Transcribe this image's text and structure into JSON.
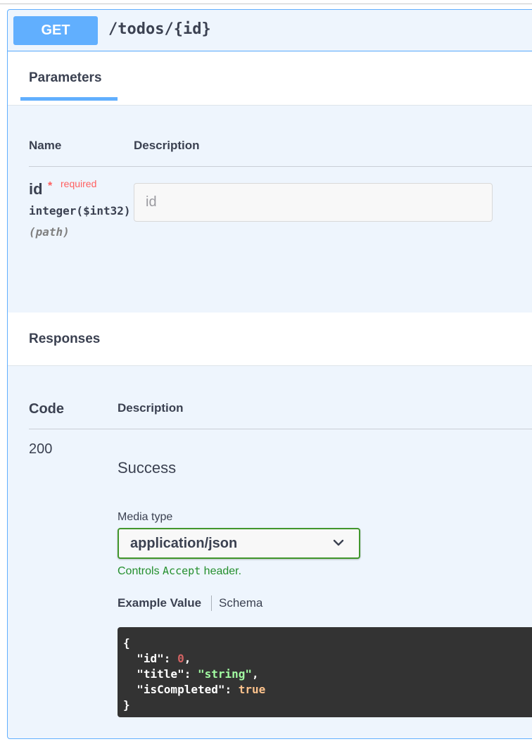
{
  "operation": {
    "method": "GET",
    "path": "/todos/{id}"
  },
  "parameters": {
    "tab_label": "Parameters",
    "col_name": "Name",
    "col_description": "Description",
    "items": [
      {
        "name": "id",
        "star": "*",
        "required_label": "required",
        "type": "integer($int32)",
        "in": "(path)",
        "placeholder": "id"
      }
    ]
  },
  "responses": {
    "title": "Responses",
    "col_code": "Code",
    "col_description": "Description",
    "items": [
      {
        "code": "200",
        "description": "Success",
        "media_type_label": "Media type",
        "media_type_value": "application/json",
        "controls_prefix": "Controls ",
        "controls_mono": "Accept",
        "controls_suffix": " header.",
        "tab_example": "Example Value",
        "tab_schema": "Schema",
        "example": {
          "open": "{",
          "id_key": "\"id\"",
          "id_val": "0",
          "title_key": "\"title\"",
          "title_val": "\"string\"",
          "completed_key": "\"isCompleted\"",
          "completed_val": "true",
          "close": "}"
        }
      }
    ]
  },
  "colors": {
    "get_blue": "#61affe",
    "block_bg": "#eef5fd",
    "required_red": "#ff6060",
    "select_green": "#41962c",
    "code_bg": "#333333"
  },
  "icons": {
    "select_chevron": "chevron-down-icon"
  }
}
